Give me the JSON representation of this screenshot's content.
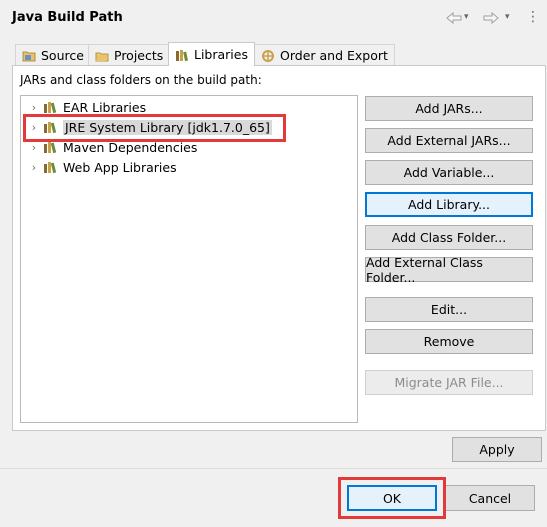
{
  "dialog": {
    "title": "Java Build Path"
  },
  "tabs": [
    {
      "label": "Source"
    },
    {
      "label": "Projects"
    },
    {
      "label": "Libraries"
    },
    {
      "label": "Order and Export"
    }
  ],
  "libraries": {
    "description": "JARs and class folders on the build path:",
    "items": [
      {
        "label": "EAR Libraries"
      },
      {
        "label": "JRE System Library [jdk1.7.0_65]"
      },
      {
        "label": "Maven Dependencies"
      },
      {
        "label": "Web App Libraries"
      }
    ]
  },
  "buttons": {
    "add_jars": "Add JARs...",
    "add_external_jars": "Add External JARs...",
    "add_variable": "Add Variable...",
    "add_library": "Add Library...",
    "add_class_folder": "Add Class Folder...",
    "add_external_class_folder": "Add External Class Folder...",
    "edit": "Edit...",
    "remove": "Remove",
    "migrate_jar": "Migrate JAR File...",
    "apply": "Apply",
    "ok": "OK",
    "cancel": "Cancel"
  },
  "colors": {
    "highlight": "#e23a3a",
    "focus": "#0078d7"
  }
}
